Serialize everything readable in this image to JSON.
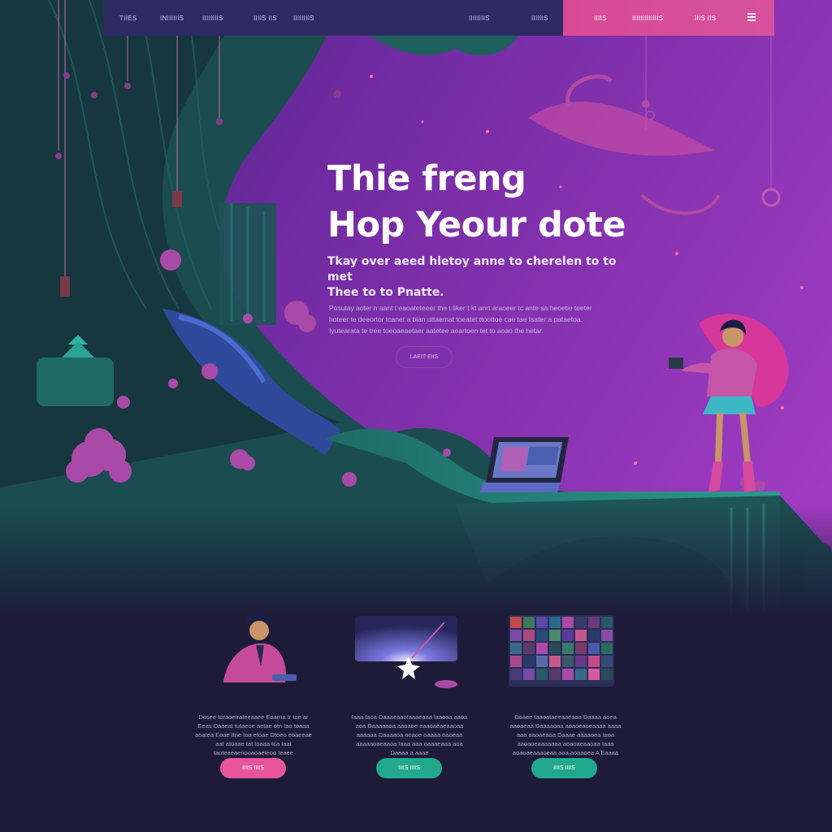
{
  "colors": {
    "nav_bg": "#2d2b63",
    "nav_accent": "#d94a95",
    "sky_top": "#6f2aa0",
    "sky_right": "#9b3bbe",
    "cave_green": "#1f5a58",
    "pink_button": "#e8559a",
    "teal_button": "#22a98d"
  },
  "nav": {
    "items": [
      "TIIES",
      "INIIIIIIS",
      "IIIIIIIIS",
      "IIIIS IIS",
      "IIIIIIIIS"
    ],
    "right_items": [
      "IIIIIIIIS",
      "IIIIIIS"
    ],
    "accent_items": [
      "IIIIS",
      "IIIIIIIIIIIIIS",
      "IIIS IIS"
    ],
    "menu_icon": "hamburger-menu-icon"
  },
  "hero": {
    "title_line1": "Thie freng",
    "title_line2": "Hop Yeour dote",
    "subtitle_line1": "Tkay over aeed hletoy anne to cherelen to to met",
    "subtitle_line2": "Thee to to Pnatte.",
    "body": "Posutay aoter h aant t eaoateteeer the t liker t kt anrt araoeer tc ante sa heoetie teeter hoteer te deeortor tcanet a bian uttaemat toeatet ttoottoe cae tae Isater a pataetoa. Iyutearata te tree toeoaeaetaer aatetee aeartoen tet to aoao the hetar.",
    "cta_label": "LAEIT EIIS"
  },
  "features": [
    {
      "image": "developer-character-illustration",
      "text": "Dosee toraoetrateeaaee Eoarna tr toe ar Eeas Daaeat tutaeoe aetae otn tao toaaa aoatea Eoae ttne toa etoae Dtoeo eoaeeae aat atoaae tat toaaa tca Iaat taoteaeaenooaoaeteoo Ieaee",
      "button_label": "IIIIS IIIIS",
      "button_color": "#e8559a"
    },
    {
      "image": "starburst-illustration",
      "text": "Iaaa taoa Daaaeaaotaaaeaaa laaoaa aaoa aoa Daaaaaoa aaoaoe eaaoaeaeaaoaa aaaaaa Daaaaoa ooaoe oaaaa oaoeaa aaaaaoaeaaoa Iaaa aaa oaaaeaaa aoa Daaaa a aaae",
      "button_label": "IIIIS IIIIS",
      "button_color": "#22a98d"
    },
    {
      "image": "photo-mosaic-illustration",
      "text": "Doaee taaoataeeaaeaoa Daaaa aoea aaoaeaa Daaaaoaa aoaoeaoeaaaa aaaa aaa aaoaeaoa Daaae aaaaoea taoa aaoaoeaaaaaaa aoaoaeaaoaa Iaaa aoaoaeaaaoeaa aoa aoaaoea A Eaaaa",
      "button_label": "IIIIS IIIIS",
      "button_color": "#22a98d"
    }
  ]
}
